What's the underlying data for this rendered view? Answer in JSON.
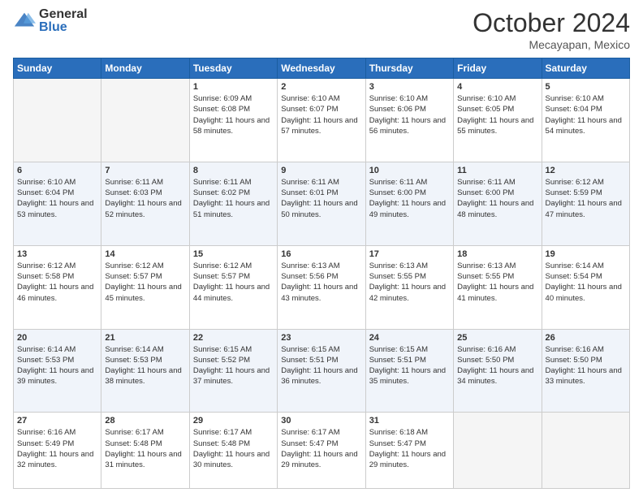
{
  "header": {
    "logo_general": "General",
    "logo_blue": "Blue",
    "month_title": "October 2024",
    "location": "Mecayapan, Mexico"
  },
  "weekdays": [
    "Sunday",
    "Monday",
    "Tuesday",
    "Wednesday",
    "Thursday",
    "Friday",
    "Saturday"
  ],
  "weeks": [
    [
      {
        "day": "",
        "sunrise": "",
        "sunset": "",
        "daylight": ""
      },
      {
        "day": "",
        "sunrise": "",
        "sunset": "",
        "daylight": ""
      },
      {
        "day": "1",
        "sunrise": "Sunrise: 6:09 AM",
        "sunset": "Sunset: 6:08 PM",
        "daylight": "Daylight: 11 hours and 58 minutes."
      },
      {
        "day": "2",
        "sunrise": "Sunrise: 6:10 AM",
        "sunset": "Sunset: 6:07 PM",
        "daylight": "Daylight: 11 hours and 57 minutes."
      },
      {
        "day": "3",
        "sunrise": "Sunrise: 6:10 AM",
        "sunset": "Sunset: 6:06 PM",
        "daylight": "Daylight: 11 hours and 56 minutes."
      },
      {
        "day": "4",
        "sunrise": "Sunrise: 6:10 AM",
        "sunset": "Sunset: 6:05 PM",
        "daylight": "Daylight: 11 hours and 55 minutes."
      },
      {
        "day": "5",
        "sunrise": "Sunrise: 6:10 AM",
        "sunset": "Sunset: 6:04 PM",
        "daylight": "Daylight: 11 hours and 54 minutes."
      }
    ],
    [
      {
        "day": "6",
        "sunrise": "Sunrise: 6:10 AM",
        "sunset": "Sunset: 6:04 PM",
        "daylight": "Daylight: 11 hours and 53 minutes."
      },
      {
        "day": "7",
        "sunrise": "Sunrise: 6:11 AM",
        "sunset": "Sunset: 6:03 PM",
        "daylight": "Daylight: 11 hours and 52 minutes."
      },
      {
        "day": "8",
        "sunrise": "Sunrise: 6:11 AM",
        "sunset": "Sunset: 6:02 PM",
        "daylight": "Daylight: 11 hours and 51 minutes."
      },
      {
        "day": "9",
        "sunrise": "Sunrise: 6:11 AM",
        "sunset": "Sunset: 6:01 PM",
        "daylight": "Daylight: 11 hours and 50 minutes."
      },
      {
        "day": "10",
        "sunrise": "Sunrise: 6:11 AM",
        "sunset": "Sunset: 6:00 PM",
        "daylight": "Daylight: 11 hours and 49 minutes."
      },
      {
        "day": "11",
        "sunrise": "Sunrise: 6:11 AM",
        "sunset": "Sunset: 6:00 PM",
        "daylight": "Daylight: 11 hours and 48 minutes."
      },
      {
        "day": "12",
        "sunrise": "Sunrise: 6:12 AM",
        "sunset": "Sunset: 5:59 PM",
        "daylight": "Daylight: 11 hours and 47 minutes."
      }
    ],
    [
      {
        "day": "13",
        "sunrise": "Sunrise: 6:12 AM",
        "sunset": "Sunset: 5:58 PM",
        "daylight": "Daylight: 11 hours and 46 minutes."
      },
      {
        "day": "14",
        "sunrise": "Sunrise: 6:12 AM",
        "sunset": "Sunset: 5:57 PM",
        "daylight": "Daylight: 11 hours and 45 minutes."
      },
      {
        "day": "15",
        "sunrise": "Sunrise: 6:12 AM",
        "sunset": "Sunset: 5:57 PM",
        "daylight": "Daylight: 11 hours and 44 minutes."
      },
      {
        "day": "16",
        "sunrise": "Sunrise: 6:13 AM",
        "sunset": "Sunset: 5:56 PM",
        "daylight": "Daylight: 11 hours and 43 minutes."
      },
      {
        "day": "17",
        "sunrise": "Sunrise: 6:13 AM",
        "sunset": "Sunset: 5:55 PM",
        "daylight": "Daylight: 11 hours and 42 minutes."
      },
      {
        "day": "18",
        "sunrise": "Sunrise: 6:13 AM",
        "sunset": "Sunset: 5:55 PM",
        "daylight": "Daylight: 11 hours and 41 minutes."
      },
      {
        "day": "19",
        "sunrise": "Sunrise: 6:14 AM",
        "sunset": "Sunset: 5:54 PM",
        "daylight": "Daylight: 11 hours and 40 minutes."
      }
    ],
    [
      {
        "day": "20",
        "sunrise": "Sunrise: 6:14 AM",
        "sunset": "Sunset: 5:53 PM",
        "daylight": "Daylight: 11 hours and 39 minutes."
      },
      {
        "day": "21",
        "sunrise": "Sunrise: 6:14 AM",
        "sunset": "Sunset: 5:53 PM",
        "daylight": "Daylight: 11 hours and 38 minutes."
      },
      {
        "day": "22",
        "sunrise": "Sunrise: 6:15 AM",
        "sunset": "Sunset: 5:52 PM",
        "daylight": "Daylight: 11 hours and 37 minutes."
      },
      {
        "day": "23",
        "sunrise": "Sunrise: 6:15 AM",
        "sunset": "Sunset: 5:51 PM",
        "daylight": "Daylight: 11 hours and 36 minutes."
      },
      {
        "day": "24",
        "sunrise": "Sunrise: 6:15 AM",
        "sunset": "Sunset: 5:51 PM",
        "daylight": "Daylight: 11 hours and 35 minutes."
      },
      {
        "day": "25",
        "sunrise": "Sunrise: 6:16 AM",
        "sunset": "Sunset: 5:50 PM",
        "daylight": "Daylight: 11 hours and 34 minutes."
      },
      {
        "day": "26",
        "sunrise": "Sunrise: 6:16 AM",
        "sunset": "Sunset: 5:50 PM",
        "daylight": "Daylight: 11 hours and 33 minutes."
      }
    ],
    [
      {
        "day": "27",
        "sunrise": "Sunrise: 6:16 AM",
        "sunset": "Sunset: 5:49 PM",
        "daylight": "Daylight: 11 hours and 32 minutes."
      },
      {
        "day": "28",
        "sunrise": "Sunrise: 6:17 AM",
        "sunset": "Sunset: 5:48 PM",
        "daylight": "Daylight: 11 hours and 31 minutes."
      },
      {
        "day": "29",
        "sunrise": "Sunrise: 6:17 AM",
        "sunset": "Sunset: 5:48 PM",
        "daylight": "Daylight: 11 hours and 30 minutes."
      },
      {
        "day": "30",
        "sunrise": "Sunrise: 6:17 AM",
        "sunset": "Sunset: 5:47 PM",
        "daylight": "Daylight: 11 hours and 29 minutes."
      },
      {
        "day": "31",
        "sunrise": "Sunrise: 6:18 AM",
        "sunset": "Sunset: 5:47 PM",
        "daylight": "Daylight: 11 hours and 29 minutes."
      },
      {
        "day": "",
        "sunrise": "",
        "sunset": "",
        "daylight": ""
      },
      {
        "day": "",
        "sunrise": "",
        "sunset": "",
        "daylight": ""
      }
    ]
  ]
}
